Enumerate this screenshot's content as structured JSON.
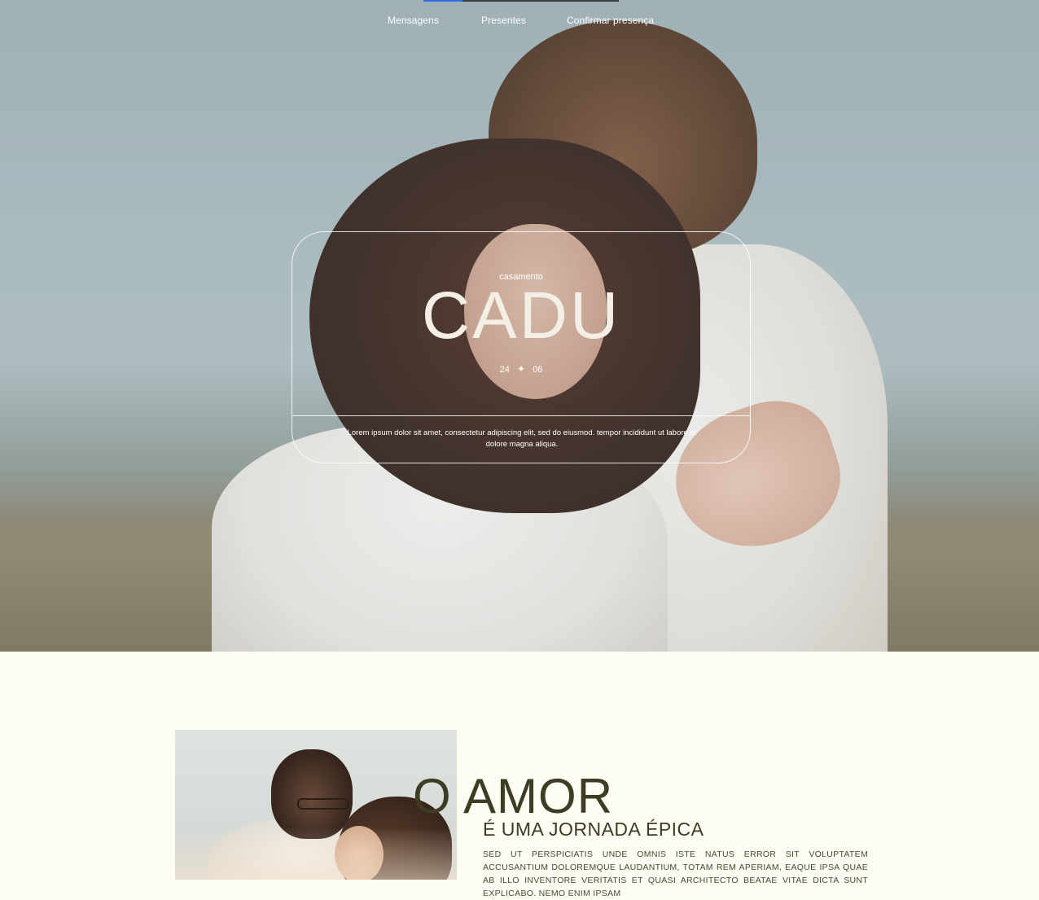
{
  "nav": {
    "items": [
      {
        "label": "Mensagens"
      },
      {
        "label": "Presentes"
      },
      {
        "label": "Confirmar presença"
      }
    ],
    "active_accent_color": "#2f6fe0"
  },
  "hero": {
    "eyebrow": "casamento",
    "title": "CADU",
    "date_day": "24",
    "date_separator": "✦",
    "date_month": "06",
    "description": "Lorem ipsum dolor sit amet, consectetur adipiscing elit, sed do eiusmod. tempor incididunt ut labore et dolore magna aliqua."
  },
  "love": {
    "title": "O AMOR",
    "subtitle": "É UMA JORNADA ÉPICA",
    "body": "SED UT PERSPICIATIS UNDE OMNIS ISTE NATUS ERROR SIT VOLUPTATEM ACCUSANTIUM DOLOREMQUE LAUDANTIUM, TOTAM REM APERIAM, EAQUE IPSA QUAE AB ILLO INVENTORE VERITATIS ET QUASI ARCHITECTO BEATAE VITAE DICTA SUNT EXPLICABO. NEMO ENIM IPSAM"
  },
  "colors": {
    "page_background": "#fdfdf4",
    "heading_text": "#3d3d24"
  }
}
